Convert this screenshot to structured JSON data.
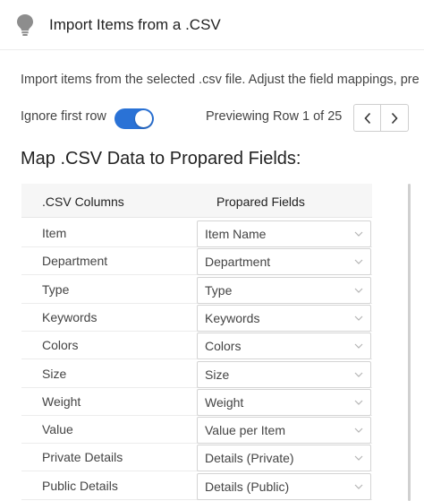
{
  "header": {
    "title": "Import Items from a .CSV",
    "icon": "lightbulb-icon"
  },
  "description": "Import items from the selected .csv file. Adjust the field mappings, pre",
  "controls": {
    "ignore_first_row_label": "Ignore first row",
    "ignore_first_row_on": true,
    "preview_label": "Previewing Row 1 of 25",
    "prev_icon": "chevron-left-icon",
    "next_icon": "chevron-right-icon"
  },
  "mapping": {
    "title": "Map .CSV Data to Propared Fields:",
    "columns": {
      "csv": ".CSV Columns",
      "prop": "Propared Fields"
    },
    "rows": [
      {
        "csv": "Item",
        "field": "Item Name"
      },
      {
        "csv": "Department",
        "field": "Department"
      },
      {
        "csv": "Type",
        "field": "Type"
      },
      {
        "csv": "Keywords",
        "field": "Keywords"
      },
      {
        "csv": "Colors",
        "field": "Colors"
      },
      {
        "csv": "Size",
        "field": "Size"
      },
      {
        "csv": "Weight",
        "field": "Weight"
      },
      {
        "csv": "Value",
        "field": "Value per Item"
      },
      {
        "csv": "Private Details",
        "field": "Details (Private)"
      },
      {
        "csv": "Public Details",
        "field": "Details (Public)"
      }
    ]
  },
  "colors": {
    "accent": "#2a72d6",
    "border": "#d4d4d4",
    "header_bg": "#f6f6f6"
  }
}
